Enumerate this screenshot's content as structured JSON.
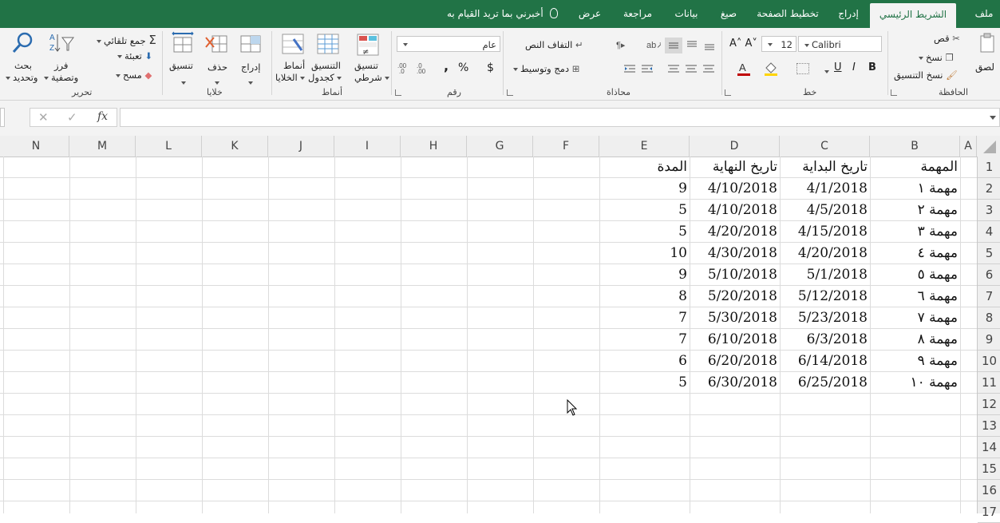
{
  "tabs": [
    {
      "label": "ملف"
    },
    {
      "label": "الشريط الرئيسي"
    },
    {
      "label": "إدراج"
    },
    {
      "label": "تخطيط الصفحة"
    },
    {
      "label": "صيغ"
    },
    {
      "label": "بيانات"
    },
    {
      "label": "مراجعة"
    },
    {
      "label": "عرض"
    }
  ],
  "tell_me": "أخبرني بما تريد القيام به",
  "ribbon": {
    "clipboard": {
      "group": "الحافظة",
      "paste": "لصق",
      "cut": "قص",
      "copy": "نسخ",
      "format_painter": "نسخ التنسيق"
    },
    "font": {
      "group": "خط",
      "font_name": "Calibri",
      "font_size": "12",
      "bold": "B",
      "italic": "I",
      "underline": "U"
    },
    "alignment": {
      "group": "محاذاة",
      "wrap_text": "التفاف النص",
      "merge_center": "دمج وتوسيط"
    },
    "number": {
      "group": "رقم",
      "format": "عام",
      "currency": "$",
      "percent": "%",
      "comma": ","
    },
    "styles": {
      "group": "أنماط",
      "conditional": "تنسيق",
      "conditional2": "شرطي",
      "as_table": "التنسيق",
      "as_table2": "كجدول",
      "cell_styles": "أنماط",
      "cell_styles2": "الخلايا"
    },
    "cells": {
      "group": "خلايا",
      "insert": "إدراج",
      "delete": "حذف",
      "format": "تنسيق"
    },
    "editing": {
      "group": "تحرير",
      "autosum": "جمع تلقائي",
      "fill": "تعبئة",
      "clear": "مسح",
      "sort": "فرز",
      "sort2": "وتصفية",
      "find": "بحث",
      "find2": "وتحديد"
    }
  },
  "formula_bar": {
    "fx": "fx",
    "value": ""
  },
  "columns": [
    "A",
    "B",
    "C",
    "D",
    "E",
    "F",
    "G",
    "H",
    "I",
    "J",
    "K",
    "L",
    "M",
    "N"
  ],
  "rows": [
    "1",
    "2",
    "3",
    "4",
    "5",
    "6",
    "7",
    "8",
    "9",
    "10",
    "11",
    "12",
    "13",
    "14",
    "15",
    "16",
    "17"
  ],
  "sheet": {
    "headers": {
      "task": "المهمة",
      "start": "تاريخ البداية",
      "end": "تاريخ النهاية",
      "duration": "المدة"
    },
    "data": [
      {
        "task": "مهمة ١",
        "start": "4/1/2018",
        "end": "4/10/2018",
        "duration": "9"
      },
      {
        "task": "مهمة ٢",
        "start": "4/5/2018",
        "end": "4/10/2018",
        "duration": "5"
      },
      {
        "task": "مهمة ٣",
        "start": "4/15/2018",
        "end": "4/20/2018",
        "duration": "5"
      },
      {
        "task": "مهمة ٤",
        "start": "4/20/2018",
        "end": "4/30/2018",
        "duration": "10"
      },
      {
        "task": "مهمة ٥",
        "start": "5/1/2018",
        "end": "5/10/2018",
        "duration": "9"
      },
      {
        "task": "مهمة ٦",
        "start": "5/12/2018",
        "end": "5/20/2018",
        "duration": "8"
      },
      {
        "task": "مهمة ٧",
        "start": "5/23/2018",
        "end": "5/30/2018",
        "duration": "7"
      },
      {
        "task": "مهمة ٨",
        "start": "6/3/2018",
        "end": "6/10/2018",
        "duration": "7"
      },
      {
        "task": "مهمة ٩",
        "start": "6/14/2018",
        "end": "6/20/2018",
        "duration": "6"
      },
      {
        "task": "مهمة ١٠",
        "start": "6/25/2018",
        "end": "6/30/2018",
        "duration": "5"
      }
    ]
  },
  "colors": {
    "accent": "#217346",
    "ribbon_bg": "#f3f3f3",
    "header_bg": "#efefef",
    "grid": "#dcdcdc"
  }
}
